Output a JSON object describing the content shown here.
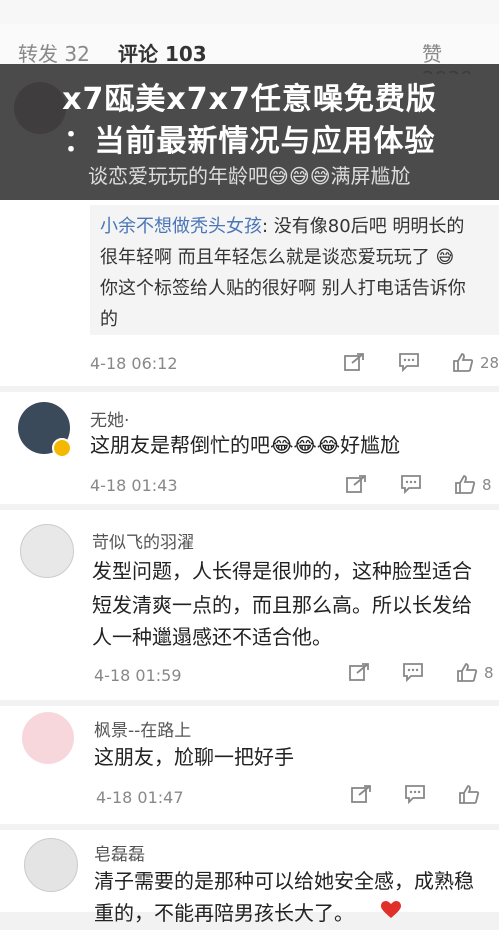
{
  "tabs": {
    "forward": "转发 32",
    "comments": "评论 103",
    "likes": "赞 2930"
  },
  "overlay": {
    "line1": "x7瓯美x7x7任意噪免费版",
    "line2": "：当前最新情况与应用体验"
  },
  "first_comment": {
    "text_tail": "谈恋爱玩玩的年龄吧😅😅😅满屏尴尬"
  },
  "quote": {
    "author": "小余不想做秃头女孩",
    "text1": ": 没有像80后吧 明明长的",
    "text2": "很年轻啊  而且年轻怎么就是谈恋爱玩玩了 😅",
    "text3": "你这个标签给人贴的很好啊 别人打电话告诉你",
    "text4": "的"
  },
  "first_meta": {
    "time": "4-18 06:12",
    "likes": "28"
  },
  "comments": [
    {
      "user": "无她·",
      "lines": [
        "这朋友是帮倒忙的吧😂😂😂好尴尬"
      ],
      "time": "4-18 01:43",
      "likes": "8"
    },
    {
      "user": "苛似飞的羽濯",
      "lines": [
        "发型问题，人长得是很帅的，这种脸型适合",
        "短发清爽一点的，而且那么高。所以长发给",
        "人一种邋遢感还不适合他。"
      ],
      "time": "4-18 01:59",
      "likes": "8"
    },
    {
      "user": "枫景--在路上",
      "lines": [
        "这朋友，尬聊一把好手"
      ],
      "time": "4-18 01:47",
      "likes": ""
    },
    {
      "user": "皂磊磊",
      "lines": [
        "清子需要的是那种可以给她安全感，成熟稳",
        "重的，不能再陪男孩长大了。"
      ],
      "time": "",
      "likes": ""
    }
  ],
  "icons": {
    "share": "share-icon",
    "comment": "comment-icon",
    "like": "thumbs-up-icon",
    "heart": "heart-icon"
  },
  "colors": {
    "link": "#4a76b8",
    "overlay": "#323232",
    "badge": "#f5b800",
    "heart": "#e0302a"
  }
}
